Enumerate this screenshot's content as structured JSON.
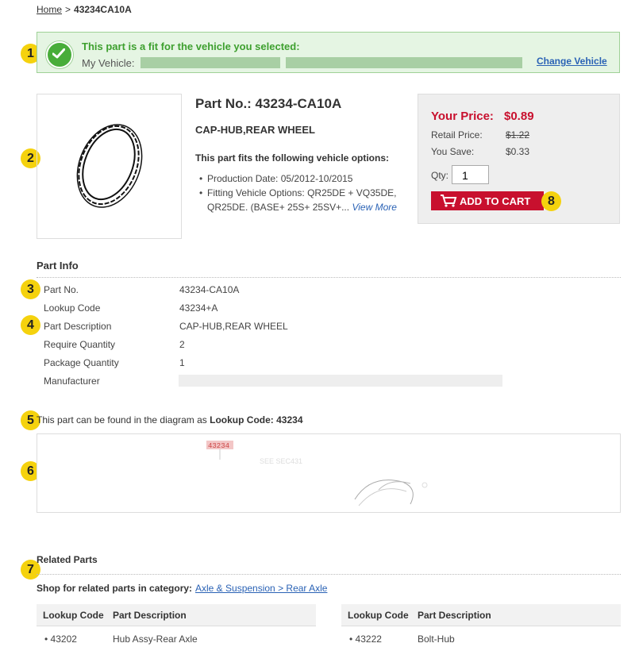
{
  "breadcrumb": {
    "home": "Home",
    "separator": ">",
    "current": "43234CA10A"
  },
  "badges": [
    "1",
    "2",
    "3",
    "4",
    "5",
    "6",
    "7",
    "8"
  ],
  "fitment": {
    "title": "This part is a fit for the vehicle you selected:",
    "vehicle_label": "My Vehicle:",
    "change_link": "Change Vehicle"
  },
  "part": {
    "title": "Part No.: 43234-CA10A",
    "name": "CAP-HUB,REAR WHEEL",
    "fits_heading": "This part fits the following vehicle options:",
    "options": [
      "Production Date: 05/2012-10/2015",
      "Fitting Vehicle Options: QR25DE + VQ35DE, QR25DE. (BASE+ 25S+ 25SV+..."
    ],
    "view_more": "View More"
  },
  "price": {
    "your_price_label": "Your Price:",
    "your_price": "$0.89",
    "retail_label": "Retail Price:",
    "retail": "$1.22",
    "save_label": "You Save:",
    "save": "$0.33",
    "qty_label": "Qty:",
    "qty": "1",
    "add_to_cart": "ADD TO CART"
  },
  "part_info": {
    "heading": "Part Info",
    "rows": [
      {
        "label": "Part No.",
        "value": "43234-CA10A"
      },
      {
        "label": "Lookup Code",
        "value": "43234+A"
      },
      {
        "label": "Part Description",
        "value": "CAP-HUB,REAR WHEEL"
      },
      {
        "label": "Require Quantity",
        "value": "2"
      },
      {
        "label": "Package Quantity",
        "value": "1"
      },
      {
        "label": "Manufacturer",
        "value": ""
      }
    ]
  },
  "diagram": {
    "text_prefix": "This part can be found in the diagram as ",
    "text_bold": "Lookup Code: 43234",
    "callout": "43234",
    "see_sec": "SEE SEC431"
  },
  "related": {
    "heading": "Related Parts",
    "shop_text": "Shop for related parts in category:",
    "category_link": "Axle & Suspension > Rear Axle",
    "columns": [
      "Lookup Code",
      "Part Description"
    ],
    "left_rows": [
      {
        "code": "43202",
        "desc": "Hub Assy-Rear Axle"
      }
    ],
    "right_rows": [
      {
        "code": "43222",
        "desc": "Bolt-Hub"
      }
    ]
  },
  "colors": {
    "accent_red": "#c8102e",
    "fit_green": "#3ea02f",
    "link_blue": "#2a62b5",
    "badge_yellow": "#f5d20e"
  }
}
